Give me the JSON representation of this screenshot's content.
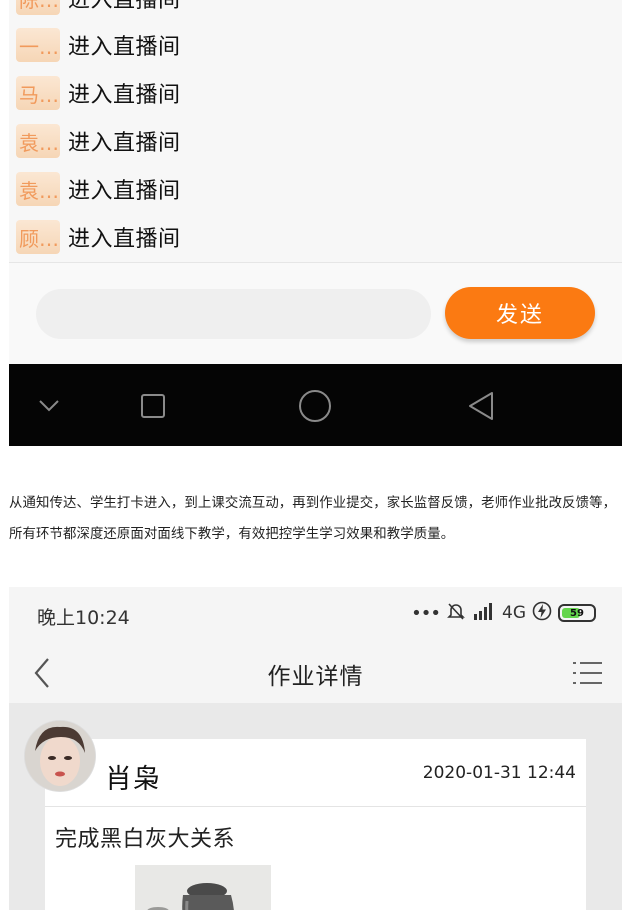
{
  "chat": {
    "rows": [
      {
        "avatar": "陈…",
        "text": "进入直播间"
      },
      {
        "avatar": "一…",
        "text": "进入直播间"
      },
      {
        "avatar": "马…",
        "text": "进入直播间"
      },
      {
        "avatar": "袁…",
        "text": "进入直播间"
      },
      {
        "avatar": "袁…",
        "text": "进入直播间"
      },
      {
        "avatar": "顾…",
        "text": "进入直播间"
      }
    ],
    "send_label": "发送"
  },
  "caption": "从通知传达、学生打卡进入，到上课交流互动，再到作业提交，家长监督反馈，老师作业批改反馈等，所有环节都深度还原面对面线下教学，有效把控学生学习效果和教学质量。",
  "detail": {
    "status": {
      "time": "晚上10:24",
      "network": "4G",
      "battery": "59",
      "battery_level": 0.59
    },
    "header": {
      "title": "作业详情"
    },
    "post": {
      "user_name": "肖枭",
      "timestamp": "2020-01-31 12:44",
      "assignment_title": "完成黑白灰大关系"
    }
  },
  "colors": {
    "accent": "#fb7a12",
    "avatar_text": "#f19a5c",
    "nav_bar": "#050505",
    "battery": "#64d54c"
  },
  "icons": [
    "chevron-down-icon",
    "square-icon",
    "circle-icon",
    "triangle-back-icon",
    "back-arrow-icon",
    "menu-list-icon",
    "mute-bell-icon",
    "signal-icon",
    "charging-icon"
  ]
}
